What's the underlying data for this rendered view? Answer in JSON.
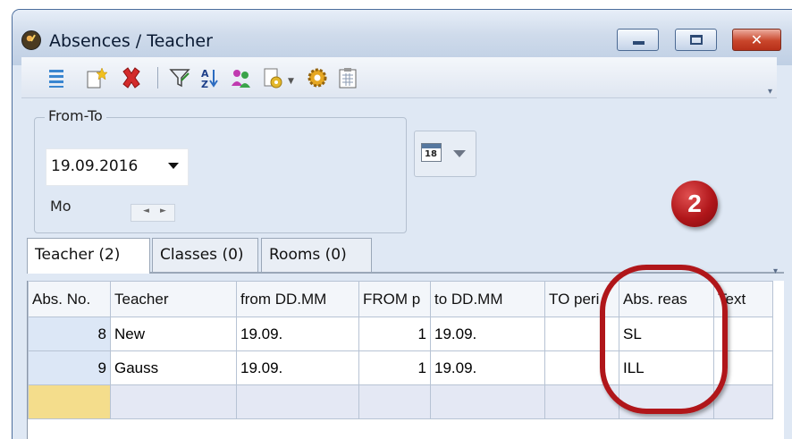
{
  "window": {
    "title": "Absences / Teacher",
    "controls": {
      "minimize": "minimize",
      "maximize": "maximize",
      "close": "✕"
    }
  },
  "toolbar": {
    "icons": [
      "list-icon",
      "new-record-icon",
      "delete-icon",
      "filter-icon",
      "sort-icon",
      "people-icon",
      "report-icon",
      "settings-icon",
      "clipboard-icon"
    ]
  },
  "filter": {
    "group_label": "From-To",
    "date_value": "19.09.2016",
    "weekday": "Mo",
    "calendar_icon_text": "18"
  },
  "badge": {
    "number": "2"
  },
  "tabs": [
    {
      "label": "Teacher (2)",
      "active": true
    },
    {
      "label": "Classes (0)",
      "active": false
    },
    {
      "label": "Rooms (0)",
      "active": false
    }
  ],
  "grid": {
    "columns": [
      "Abs. No.",
      "Teacher",
      "from DD.MM",
      "FROM p",
      "to DD.MM",
      "TO peri",
      "Abs. reas",
      "Text"
    ],
    "rows": [
      [
        "8",
        "New",
        "19.09.",
        "1",
        "19.09.",
        "",
        "SL",
        ""
      ],
      [
        "9",
        "Gauss",
        "19.09.",
        "1",
        "19.09.",
        "",
        "ILL",
        ""
      ]
    ]
  },
  "colors": {
    "title_bar": "#cfdbeb",
    "badge_red": "#b0161a",
    "new_row_yellow": "#f4dd8c",
    "selected_cell_blue": "#dce7f6"
  }
}
